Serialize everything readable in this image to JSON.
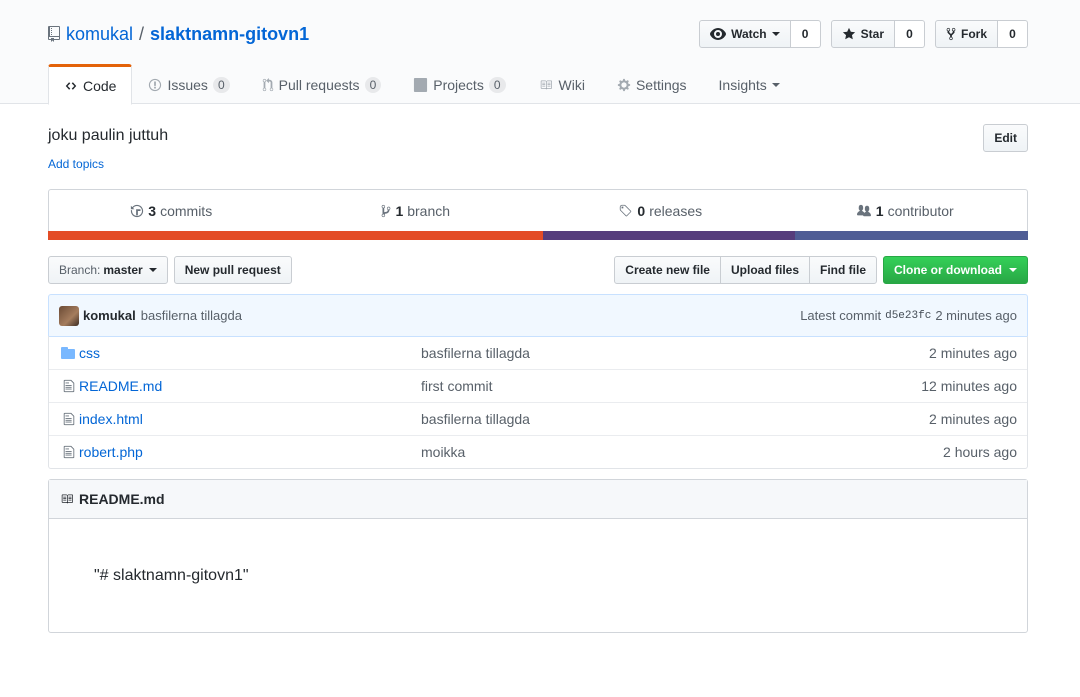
{
  "repo": {
    "owner": "komukal",
    "separator": "/",
    "name": "slaktnamn-gitovn1"
  },
  "actions": {
    "watch_label": "Watch",
    "watch_count": "0",
    "star_label": "Star",
    "star_count": "0",
    "fork_label": "Fork",
    "fork_count": "0"
  },
  "nav": {
    "code": "Code",
    "issues": "Issues",
    "issues_count": "0",
    "pulls": "Pull requests",
    "pulls_count": "0",
    "projects": "Projects",
    "projects_count": "0",
    "wiki": "Wiki",
    "settings": "Settings",
    "insights": "Insights"
  },
  "meta": {
    "description": "joku paulin juttuh",
    "add_topics": "Add topics",
    "edit_label": "Edit"
  },
  "summary": {
    "commits_num": "3",
    "commits_label": "commits",
    "branch_num": "1",
    "branch_label": "branch",
    "releases_num": "0",
    "releases_label": "releases",
    "contributors_num": "1",
    "contributors_label": "contributor"
  },
  "language_bar": [
    {
      "color": "#e34c26",
      "percent": 50.5
    },
    {
      "color": "#563d7c",
      "percent": 25.7
    },
    {
      "color": "#4F5D95",
      "percent": 23.8
    }
  ],
  "file_nav": {
    "branch_prefix": "Branch:",
    "branch_name": "master",
    "new_pr": "New pull request",
    "create_file": "Create new file",
    "upload_files": "Upload files",
    "find_file": "Find file",
    "clone": "Clone or download"
  },
  "latest_commit": {
    "author": "komukal",
    "message": "basfilerna tillagda",
    "label": "Latest commit",
    "sha": "d5e23fc",
    "age": "2 minutes ago"
  },
  "files": [
    {
      "type": "folder",
      "name": "css",
      "message": "basfilerna tillagda",
      "age": "2 minutes ago"
    },
    {
      "type": "file",
      "name": "README.md",
      "message": "first commit",
      "age": "12 minutes ago"
    },
    {
      "type": "file",
      "name": "index.html",
      "message": "basfilerna tillagda",
      "age": "2 minutes ago"
    },
    {
      "type": "file",
      "name": "robert.php",
      "message": "moikka",
      "age": "2 hours ago"
    }
  ],
  "readme": {
    "filename": "README.md",
    "content": "\"# slaktnamn-gitovn1\""
  },
  "colors": {
    "link": "#0366d6",
    "active_tab": "#e36209",
    "primary_button": "#28a745"
  }
}
